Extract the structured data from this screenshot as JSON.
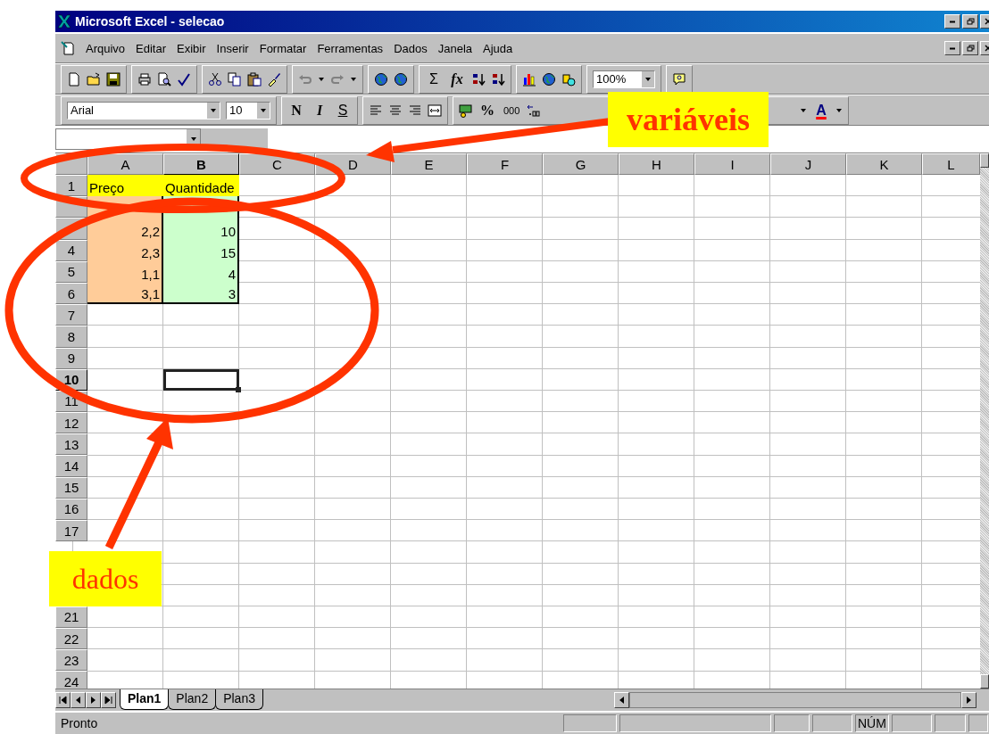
{
  "window": {
    "title": "Microsoft Excel - selecao"
  },
  "menu": [
    "Arquivo",
    "Editar",
    "Exibir",
    "Inserir",
    "Formatar",
    "Ferramentas",
    "Dados",
    "Janela",
    "Ajuda"
  ],
  "standard_toolbar": {
    "sum": "Σ",
    "function": "fx",
    "zoom": "100%"
  },
  "formatting_toolbar": {
    "font": "Arial",
    "size": "10",
    "bold": "N",
    "italic": "I",
    "underline": "S",
    "percent": "%",
    "thousands": "000",
    "font_color": "A"
  },
  "columns": [
    {
      "label": "A",
      "selected": false
    },
    {
      "label": "B",
      "selected": true
    },
    {
      "label": "C",
      "selected": false
    },
    {
      "label": "D",
      "selected": false
    },
    {
      "label": "E",
      "selected": false
    },
    {
      "label": "F",
      "selected": false
    },
    {
      "label": "G",
      "selected": false
    },
    {
      "label": "H",
      "selected": false
    },
    {
      "label": "I",
      "selected": false
    },
    {
      "label": "J",
      "selected": false
    },
    {
      "label": "K",
      "selected": false
    },
    {
      "label": "L",
      "selected": false
    }
  ],
  "rows": [
    {
      "kind": "row",
      "number": "1",
      "selected": false,
      "cells": [
        {
          "kind": "text",
          "text": "Preço",
          "color": "#ffff00",
          "selected": false
        },
        {
          "kind": "text",
          "text": "Quantidade",
          "color": "#ffff00",
          "selected": false
        }
      ]
    },
    {
      "kind": "row",
      "selected": false,
      "cells": [
        {
          "kind": "number",
          "color": "#ffcc99",
          "selected": false
        },
        {
          "kind": "number",
          "color": "#ccffcc",
          "selected": false
        }
      ]
    },
    {
      "kind": "row",
      "selected": false,
      "cells": [
        {
          "kind": "number",
          "text": "2,2",
          "color": "#ffcc99",
          "selected": false
        },
        {
          "kind": "number",
          "text": "10",
          "color": "#ccffcc",
          "selected": false
        }
      ]
    },
    {
      "kind": "row",
      "number": "4",
      "selected": false,
      "cells": [
        {
          "kind": "number",
          "text": "2,3",
          "color": "#ffcc99",
          "selected": false
        },
        {
          "kind": "number",
          "text": "15",
          "color": "#ccffcc",
          "selected": false
        }
      ]
    },
    {
      "kind": "row",
      "number": "5",
      "selected": false,
      "cells": [
        {
          "kind": "number",
          "text": "1,1",
          "color": "#ffcc99",
          "selected": false
        },
        {
          "kind": "number",
          "text": "4",
          "color": "#ccffcc",
          "selected": false
        }
      ]
    },
    {
      "kind": "row",
      "number": "6",
      "selected": false,
      "cells": [
        {
          "kind": "number",
          "text": "3,1",
          "color": "#ffcc99",
          "selected": false
        },
        {
          "kind": "number",
          "text": "3",
          "color": "#ccffcc",
          "selected": false
        }
      ]
    },
    {
      "kind": "row",
      "number": "7",
      "selected": false
    },
    {
      "kind": "row",
      "number": "8",
      "selected": false
    },
    {
      "kind": "row",
      "number": "9",
      "selected": false
    },
    {
      "kind": "row",
      "number": "10",
      "selected": true,
      "cells": [
        {
          "kind": "text",
          "selected": false
        },
        {
          "kind": "text",
          "selected": true
        }
      ]
    },
    {
      "kind": "row",
      "number": "11",
      "selected": false
    },
    {
      "kind": "row",
      "number": "12",
      "selected": false
    },
    {
      "kind": "row",
      "number": "13",
      "selected": false
    },
    {
      "kind": "row",
      "number": "14",
      "selected": false
    },
    {
      "kind": "row",
      "number": "15",
      "selected": false
    },
    {
      "kind": "row",
      "number": "16",
      "selected": false
    },
    {
      "kind": "row",
      "number": "17",
      "selected": false
    },
    {
      "kind": "covered"
    },
    {
      "kind": "covered"
    },
    {
      "kind": "covered"
    },
    {
      "kind": "row",
      "number": "21",
      "selected": false
    },
    {
      "kind": "row",
      "number": "22",
      "selected": false
    },
    {
      "kind": "row",
      "number": "23",
      "selected": false
    },
    {
      "kind": "row",
      "number": "24",
      "selected": false
    }
  ],
  "sheet_tabs": [
    {
      "label": "Plan1",
      "selected": true
    },
    {
      "label": "Plan2",
      "selected": false
    },
    {
      "label": "Plan3",
      "selected": false
    }
  ],
  "status_bar": {
    "message": "Pronto",
    "indicator": "NÚM"
  },
  "annotations": [
    {
      "text": "variáveis"
    },
    {
      "text": "dados"
    }
  ]
}
